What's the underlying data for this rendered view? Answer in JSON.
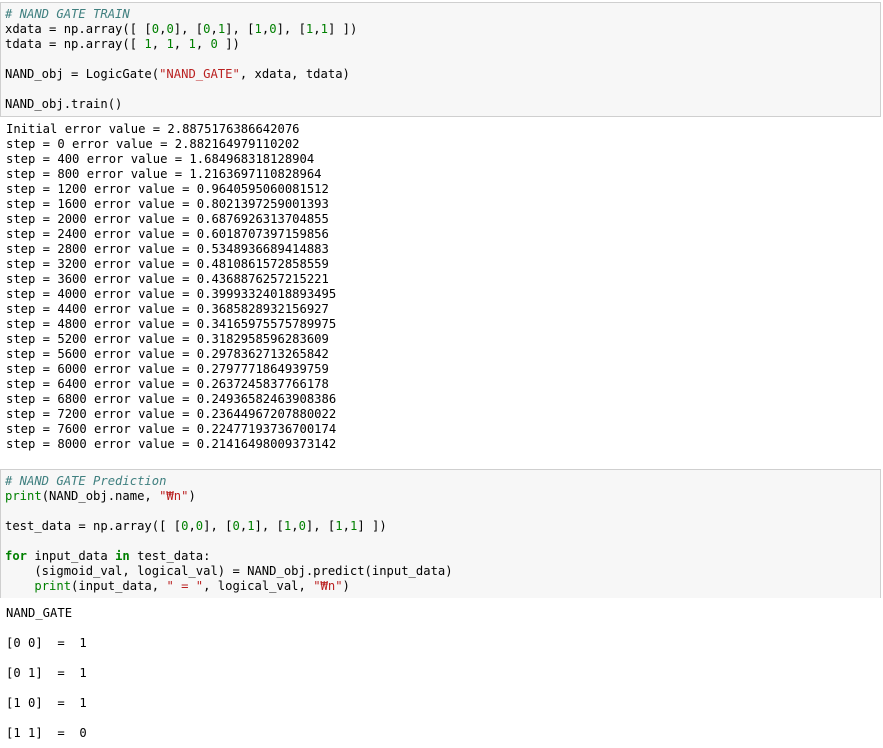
{
  "cell1": {
    "code": [
      [
        {
          "t": "cm",
          "v": "# NAND GATE TRAIN"
        }
      ],
      [
        {
          "t": "nm",
          "v": "xdata = np.array([ ["
        },
        {
          "t": "nu",
          "v": "0"
        },
        {
          "t": "nm",
          "v": ","
        },
        {
          "t": "nu",
          "v": "0"
        },
        {
          "t": "nm",
          "v": "], ["
        },
        {
          "t": "nu",
          "v": "0"
        },
        {
          "t": "nm",
          "v": ","
        },
        {
          "t": "nu",
          "v": "1"
        },
        {
          "t": "nm",
          "v": "], ["
        },
        {
          "t": "nu",
          "v": "1"
        },
        {
          "t": "nm",
          "v": ","
        },
        {
          "t": "nu",
          "v": "0"
        },
        {
          "t": "nm",
          "v": "], ["
        },
        {
          "t": "nu",
          "v": "1"
        },
        {
          "t": "nm",
          "v": ","
        },
        {
          "t": "nu",
          "v": "1"
        },
        {
          "t": "nm",
          "v": "] ])"
        }
      ],
      [
        {
          "t": "nm",
          "v": "tdata = np.array([ "
        },
        {
          "t": "nu",
          "v": "1"
        },
        {
          "t": "nm",
          "v": ", "
        },
        {
          "t": "nu",
          "v": "1"
        },
        {
          "t": "nm",
          "v": ", "
        },
        {
          "t": "nu",
          "v": "1"
        },
        {
          "t": "nm",
          "v": ", "
        },
        {
          "t": "nu",
          "v": "0"
        },
        {
          "t": "nm",
          "v": " ])"
        }
      ],
      [],
      [
        {
          "t": "nm",
          "v": "NAND_obj = LogicGate("
        },
        {
          "t": "st",
          "v": "\"NAND_GATE\""
        },
        {
          "t": "nm",
          "v": ", xdata, tdata)"
        }
      ],
      [],
      [
        {
          "t": "nm",
          "v": "NAND_obj.train()"
        }
      ]
    ]
  },
  "output1": {
    "lines": [
      "Initial error value = 2.8875176386642076",
      "step = 0 error value = 2.882164979110202",
      "step = 400 error value = 1.684968318128904",
      "step = 800 error value = 1.2163697110828964",
      "step = 1200 error value = 0.9640595060081512",
      "step = 1600 error value = 0.8021397259001393",
      "step = 2000 error value = 0.6876926313704855",
      "step = 2400 error value = 0.6018707397159856",
      "step = 2800 error value = 0.5348936689414883",
      "step = 3200 error value = 0.4810861572858559",
      "step = 3600 error value = 0.4368876257215221",
      "step = 4000 error value = 0.39993324018893495",
      "step = 4400 error value = 0.368582893215​6927",
      "step = 4800 error value = 0.34165975575789975",
      "step = 5200 error value = 0.3182958596283609",
      "step = 5600 error value = 0.2978362713265842",
      "step = 6000 error value = 0.2797771864939759",
      "step = 6400 error value = 0.2637245837766178",
      "step = 6800 error value = 0.24936582463908386",
      "step = 7200 error value = 0.23644967207880022",
      "step = 7600 error value = 0.22477193736700174",
      "step = 8000 error value = 0.21416498009373142"
    ]
  },
  "cell2": {
    "code": [
      [
        {
          "t": "cm",
          "v": "# NAND GATE Prediction"
        }
      ],
      [
        {
          "t": "bi",
          "v": "print"
        },
        {
          "t": "nm",
          "v": "(NAND_obj.name, "
        },
        {
          "t": "st",
          "v": "\"₩n\""
        },
        {
          "t": "nm",
          "v": ")"
        }
      ],
      [],
      [
        {
          "t": "nm",
          "v": "test_data = np.array([ ["
        },
        {
          "t": "nu",
          "v": "0"
        },
        {
          "t": "nm",
          "v": ","
        },
        {
          "t": "nu",
          "v": "0"
        },
        {
          "t": "nm",
          "v": "], ["
        },
        {
          "t": "nu",
          "v": "0"
        },
        {
          "t": "nm",
          "v": ","
        },
        {
          "t": "nu",
          "v": "1"
        },
        {
          "t": "nm",
          "v": "], ["
        },
        {
          "t": "nu",
          "v": "1"
        },
        {
          "t": "nm",
          "v": ","
        },
        {
          "t": "nu",
          "v": "0"
        },
        {
          "t": "nm",
          "v": "], ["
        },
        {
          "t": "nu",
          "v": "1"
        },
        {
          "t": "nm",
          "v": ","
        },
        {
          "t": "nu",
          "v": "1"
        },
        {
          "t": "nm",
          "v": "] ])"
        }
      ],
      [],
      [
        {
          "t": "kw",
          "v": "for"
        },
        {
          "t": "nm",
          "v": " input_data "
        },
        {
          "t": "kw",
          "v": "in"
        },
        {
          "t": "nm",
          "v": " test_data:"
        }
      ],
      [
        {
          "t": "nm",
          "v": "    (sigmoid_val, logical_val) = NAND_obj.predict(input_data)"
        }
      ],
      [
        {
          "t": "nm",
          "v": "    "
        },
        {
          "t": "bi",
          "v": "print"
        },
        {
          "t": "nm",
          "v": "(input_data, "
        },
        {
          "t": "st",
          "v": "\" = \""
        },
        {
          "t": "nm",
          "v": ", logical_val, "
        },
        {
          "t": "st",
          "v": "\"₩n\""
        },
        {
          "t": "nm",
          "v": ")"
        }
      ]
    ]
  },
  "output2": {
    "lines": [
      "NAND_GATE",
      "[0 0]  =  1",
      "[0 1]  =  1",
      "[1 0]  =  1",
      "[1 1]  =  0"
    ]
  }
}
